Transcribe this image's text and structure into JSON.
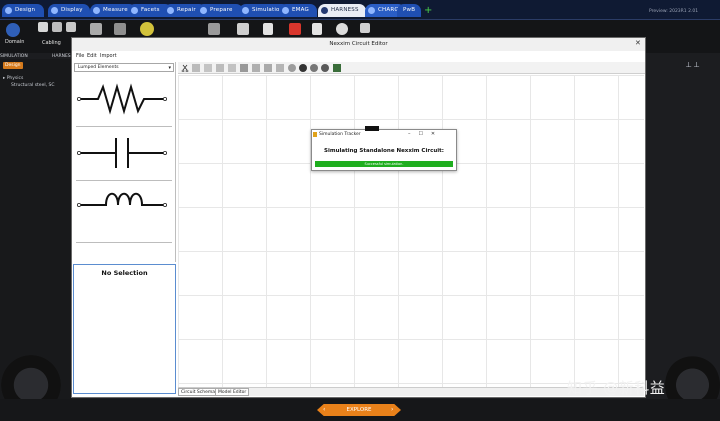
{
  "tabs": [
    {
      "label": "Design"
    },
    {
      "label": "Display"
    },
    {
      "label": "Measure"
    },
    {
      "label": "Facets"
    },
    {
      "label": "Repair"
    },
    {
      "label": "Prepare"
    },
    {
      "label": "Simulation"
    },
    {
      "label": "EMAG"
    },
    {
      "label": "HARNESS"
    },
    {
      "label": "CHARGE"
    },
    {
      "label": "PwB"
    }
  ],
  "preview_text": "Preview: 2023R1 2.01",
  "ribbon": {
    "domain_label": "Domain",
    "cabling_label": "Cabling",
    "simulation_label": "SIMULATION",
    "harness_label": "HARNES"
  },
  "tree": {
    "design_badge": "Design",
    "physics_label": "Physics",
    "structural_label": "Structural steel, SC"
  },
  "editor": {
    "title": "Nexxim Circuit Editor",
    "menu_file": "File",
    "menu_edit": "Edit",
    "menu_import": "Import",
    "dropdown_value": "Lumped Elements",
    "no_selection": "No Selection",
    "tab_schematic": "Circuit Schematic",
    "tab_model": "Model Editor"
  },
  "dialog": {
    "tooltip": "",
    "title": "Simulation Tracker",
    "message": "Simulating Standalone Nexxim Circuit:",
    "progress_text": "Successful simulation.",
    "progress": 1.0
  },
  "watermark": "知乎 @新科益",
  "bottom": {
    "explore_label": "EXPLORE"
  },
  "colors": {
    "accent_blue": "#1f4fb2",
    "explore_orange": "#e9811a",
    "progress_green": "#1fae1f"
  }
}
